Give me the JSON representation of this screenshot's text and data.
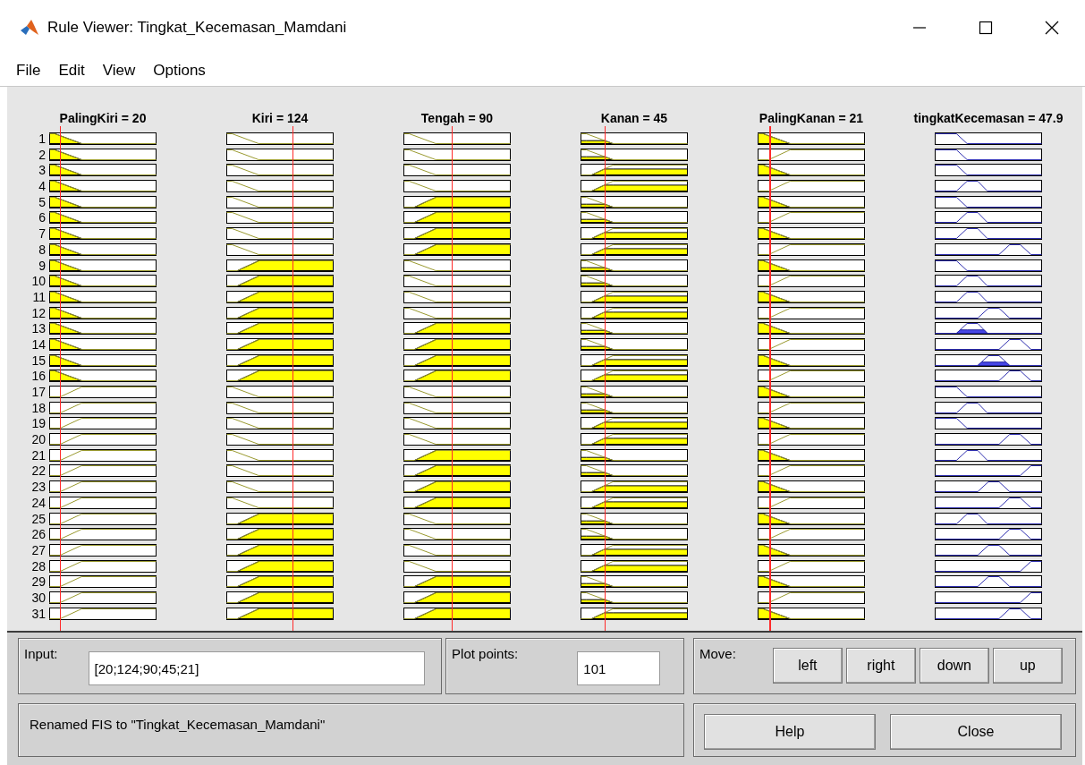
{
  "window": {
    "title": "Rule Viewer: Tingkat_Kecemasan_Mamdani"
  },
  "menu": [
    "File",
    "Edit",
    "View",
    "Options"
  ],
  "inputs": [
    {
      "label": "PalingKiri = 20"
    },
    {
      "label": "Kiri = 124"
    },
    {
      "label": "Tengah = 90"
    },
    {
      "label": "Kanan = 45"
    },
    {
      "label": "PalingKanan = 21"
    }
  ],
  "output": {
    "label": "tingkatKecemasan = 47.9"
  },
  "rules": [
    {
      "number": "1",
      "inputs": [
        {
          "kind": "low",
          "active": true
        },
        {
          "kind": "low",
          "active": false
        },
        {
          "kind": "low",
          "active": false
        },
        {
          "kind": "low",
          "active": true
        },
        {
          "kind": "low",
          "active": true
        }
      ],
      "output": {
        "kind": "vlow",
        "active": false
      }
    },
    {
      "number": "2",
      "inputs": [
        {
          "kind": "low",
          "active": true
        },
        {
          "kind": "low",
          "active": false
        },
        {
          "kind": "low",
          "active": false
        },
        {
          "kind": "low",
          "active": true
        },
        {
          "kind": "high",
          "active": false
        }
      ],
      "output": {
        "kind": "vlow",
        "active": false
      }
    },
    {
      "number": "3",
      "inputs": [
        {
          "kind": "low",
          "active": true
        },
        {
          "kind": "low",
          "active": false
        },
        {
          "kind": "low",
          "active": false
        },
        {
          "kind": "high",
          "active": true
        },
        {
          "kind": "low",
          "active": true
        }
      ],
      "output": {
        "kind": "vlow",
        "active": false
      }
    },
    {
      "number": "4",
      "inputs": [
        {
          "kind": "low",
          "active": true
        },
        {
          "kind": "low",
          "active": false
        },
        {
          "kind": "low",
          "active": false
        },
        {
          "kind": "high",
          "active": true
        },
        {
          "kind": "high",
          "active": false
        }
      ],
      "output": {
        "kind": "low",
        "active": false
      }
    },
    {
      "number": "5",
      "inputs": [
        {
          "kind": "low",
          "active": true
        },
        {
          "kind": "low",
          "active": false
        },
        {
          "kind": "high",
          "active": true
        },
        {
          "kind": "low",
          "active": true
        },
        {
          "kind": "low",
          "active": true
        }
      ],
      "output": {
        "kind": "vlow",
        "active": false
      }
    },
    {
      "number": "6",
      "inputs": [
        {
          "kind": "low",
          "active": true
        },
        {
          "kind": "low",
          "active": false
        },
        {
          "kind": "high",
          "active": true
        },
        {
          "kind": "low",
          "active": true
        },
        {
          "kind": "high",
          "active": false
        }
      ],
      "output": {
        "kind": "low",
        "active": false
      }
    },
    {
      "number": "7",
      "inputs": [
        {
          "kind": "low",
          "active": true
        },
        {
          "kind": "low",
          "active": false
        },
        {
          "kind": "high",
          "active": true
        },
        {
          "kind": "high",
          "active": true
        },
        {
          "kind": "low",
          "active": true
        }
      ],
      "output": {
        "kind": "low",
        "active": false
      }
    },
    {
      "number": "8",
      "inputs": [
        {
          "kind": "low",
          "active": true
        },
        {
          "kind": "low",
          "active": false
        },
        {
          "kind": "high",
          "active": true
        },
        {
          "kind": "high",
          "active": true
        },
        {
          "kind": "high",
          "active": false
        }
      ],
      "output": {
        "kind": "high",
        "active": false
      }
    },
    {
      "number": "9",
      "inputs": [
        {
          "kind": "low",
          "active": true
        },
        {
          "kind": "high",
          "active": true
        },
        {
          "kind": "low",
          "active": false
        },
        {
          "kind": "low",
          "active": true
        },
        {
          "kind": "low",
          "active": true
        }
      ],
      "output": {
        "kind": "vlow",
        "active": false
      }
    },
    {
      "number": "10",
      "inputs": [
        {
          "kind": "low",
          "active": true
        },
        {
          "kind": "high",
          "active": true
        },
        {
          "kind": "low",
          "active": false
        },
        {
          "kind": "low",
          "active": true
        },
        {
          "kind": "high",
          "active": false
        }
      ],
      "output": {
        "kind": "low",
        "active": false
      }
    },
    {
      "number": "11",
      "inputs": [
        {
          "kind": "low",
          "active": true
        },
        {
          "kind": "high",
          "active": true
        },
        {
          "kind": "low",
          "active": false
        },
        {
          "kind": "high",
          "active": true
        },
        {
          "kind": "low",
          "active": true
        }
      ],
      "output": {
        "kind": "low",
        "active": false
      }
    },
    {
      "number": "12",
      "inputs": [
        {
          "kind": "low",
          "active": true
        },
        {
          "kind": "high",
          "active": true
        },
        {
          "kind": "low",
          "active": false
        },
        {
          "kind": "high",
          "active": true
        },
        {
          "kind": "high",
          "active": false
        }
      ],
      "output": {
        "kind": "mid",
        "active": false
      }
    },
    {
      "number": "13",
      "inputs": [
        {
          "kind": "low",
          "active": true
        },
        {
          "kind": "high",
          "active": true
        },
        {
          "kind": "high",
          "active": true
        },
        {
          "kind": "low",
          "active": true
        },
        {
          "kind": "low",
          "active": true
        }
      ],
      "output": {
        "kind": "low",
        "active": true
      }
    },
    {
      "number": "14",
      "inputs": [
        {
          "kind": "low",
          "active": true
        },
        {
          "kind": "high",
          "active": true
        },
        {
          "kind": "high",
          "active": true
        },
        {
          "kind": "low",
          "active": true
        },
        {
          "kind": "high",
          "active": false
        }
      ],
      "output": {
        "kind": "high",
        "active": false
      }
    },
    {
      "number": "15",
      "inputs": [
        {
          "kind": "low",
          "active": true
        },
        {
          "kind": "high",
          "active": true
        },
        {
          "kind": "high",
          "active": true
        },
        {
          "kind": "high",
          "active": true
        },
        {
          "kind": "low",
          "active": true
        }
      ],
      "output": {
        "kind": "mid",
        "active": true
      }
    },
    {
      "number": "16",
      "inputs": [
        {
          "kind": "low",
          "active": true
        },
        {
          "kind": "high",
          "active": true
        },
        {
          "kind": "high",
          "active": true
        },
        {
          "kind": "high",
          "active": true
        },
        {
          "kind": "high",
          "active": false
        }
      ],
      "output": {
        "kind": "high",
        "active": false
      }
    },
    {
      "number": "17",
      "inputs": [
        {
          "kind": "high",
          "active": false
        },
        {
          "kind": "low",
          "active": false
        },
        {
          "kind": "low",
          "active": false
        },
        {
          "kind": "low",
          "active": true
        },
        {
          "kind": "low",
          "active": true
        }
      ],
      "output": {
        "kind": "vlow",
        "active": false
      }
    },
    {
      "number": "18",
      "inputs": [
        {
          "kind": "high",
          "active": false
        },
        {
          "kind": "low",
          "active": false
        },
        {
          "kind": "low",
          "active": false
        },
        {
          "kind": "low",
          "active": true
        },
        {
          "kind": "high",
          "active": false
        }
      ],
      "output": {
        "kind": "low",
        "active": false
      }
    },
    {
      "number": "19",
      "inputs": [
        {
          "kind": "high",
          "active": false
        },
        {
          "kind": "low",
          "active": false
        },
        {
          "kind": "low",
          "active": false
        },
        {
          "kind": "high",
          "active": true
        },
        {
          "kind": "low",
          "active": true
        }
      ],
      "output": {
        "kind": "vlow",
        "active": false
      }
    },
    {
      "number": "20",
      "inputs": [
        {
          "kind": "high",
          "active": false
        },
        {
          "kind": "low",
          "active": false
        },
        {
          "kind": "low",
          "active": false
        },
        {
          "kind": "high",
          "active": true
        },
        {
          "kind": "high",
          "active": false
        }
      ],
      "output": {
        "kind": "high",
        "active": false
      }
    },
    {
      "number": "21",
      "inputs": [
        {
          "kind": "high",
          "active": false
        },
        {
          "kind": "low",
          "active": false
        },
        {
          "kind": "high",
          "active": true
        },
        {
          "kind": "low",
          "active": true
        },
        {
          "kind": "low",
          "active": true
        }
      ],
      "output": {
        "kind": "low",
        "active": false
      }
    },
    {
      "number": "22",
      "inputs": [
        {
          "kind": "high",
          "active": false
        },
        {
          "kind": "low",
          "active": false
        },
        {
          "kind": "high",
          "active": true
        },
        {
          "kind": "low",
          "active": true
        },
        {
          "kind": "high",
          "active": false
        }
      ],
      "output": {
        "kind": "vhigh",
        "active": false
      }
    },
    {
      "number": "23",
      "inputs": [
        {
          "kind": "high",
          "active": false
        },
        {
          "kind": "low",
          "active": false
        },
        {
          "kind": "high",
          "active": true
        },
        {
          "kind": "high",
          "active": true
        },
        {
          "kind": "low",
          "active": true
        }
      ],
      "output": {
        "kind": "mid",
        "active": false
      }
    },
    {
      "number": "24",
      "inputs": [
        {
          "kind": "high",
          "active": false
        },
        {
          "kind": "low",
          "active": false
        },
        {
          "kind": "high",
          "active": true
        },
        {
          "kind": "high",
          "active": true
        },
        {
          "kind": "high",
          "active": false
        }
      ],
      "output": {
        "kind": "high",
        "active": false
      }
    },
    {
      "number": "25",
      "inputs": [
        {
          "kind": "high",
          "active": false
        },
        {
          "kind": "high",
          "active": true
        },
        {
          "kind": "low",
          "active": false
        },
        {
          "kind": "low",
          "active": true
        },
        {
          "kind": "low",
          "active": true
        }
      ],
      "output": {
        "kind": "low",
        "active": false
      }
    },
    {
      "number": "26",
      "inputs": [
        {
          "kind": "high",
          "active": false
        },
        {
          "kind": "high",
          "active": true
        },
        {
          "kind": "low",
          "active": false
        },
        {
          "kind": "low",
          "active": true
        },
        {
          "kind": "high",
          "active": false
        }
      ],
      "output": {
        "kind": "high",
        "active": false
      }
    },
    {
      "number": "27",
      "inputs": [
        {
          "kind": "high",
          "active": false
        },
        {
          "kind": "high",
          "active": true
        },
        {
          "kind": "low",
          "active": false
        },
        {
          "kind": "high",
          "active": true
        },
        {
          "kind": "low",
          "active": true
        }
      ],
      "output": {
        "kind": "mid",
        "active": false
      }
    },
    {
      "number": "28",
      "inputs": [
        {
          "kind": "high",
          "active": false
        },
        {
          "kind": "high",
          "active": true
        },
        {
          "kind": "low",
          "active": false
        },
        {
          "kind": "high",
          "active": true
        },
        {
          "kind": "high",
          "active": false
        }
      ],
      "output": {
        "kind": "vhigh",
        "active": false
      }
    },
    {
      "number": "29",
      "inputs": [
        {
          "kind": "high",
          "active": false
        },
        {
          "kind": "high",
          "active": true
        },
        {
          "kind": "high",
          "active": true
        },
        {
          "kind": "low",
          "active": true
        },
        {
          "kind": "low",
          "active": true
        }
      ],
      "output": {
        "kind": "mid",
        "active": false
      }
    },
    {
      "number": "30",
      "inputs": [
        {
          "kind": "high",
          "active": false
        },
        {
          "kind": "high",
          "active": true
        },
        {
          "kind": "high",
          "active": true
        },
        {
          "kind": "low",
          "active": true
        },
        {
          "kind": "high",
          "active": false
        }
      ],
      "output": {
        "kind": "vhigh",
        "active": false
      }
    },
    {
      "number": "31",
      "inputs": [
        {
          "kind": "high",
          "active": false
        },
        {
          "kind": "high",
          "active": true
        },
        {
          "kind": "high",
          "active": true
        },
        {
          "kind": "high",
          "active": true
        },
        {
          "kind": "low",
          "active": true
        }
      ],
      "output": {
        "kind": "high",
        "active": false
      }
    }
  ],
  "input_field": {
    "label": "Input:",
    "value": "[20;124;90;45;21]"
  },
  "plot_points": {
    "label": "Plot points:",
    "value": "101"
  },
  "move": {
    "label": "Move:",
    "buttons": [
      "left",
      "right",
      "down",
      "up"
    ]
  },
  "status": "Renamed FIS to \"Tingkat_Kecemasan_Mamdani\"",
  "buttons": [
    "Help",
    "Close"
  ]
}
